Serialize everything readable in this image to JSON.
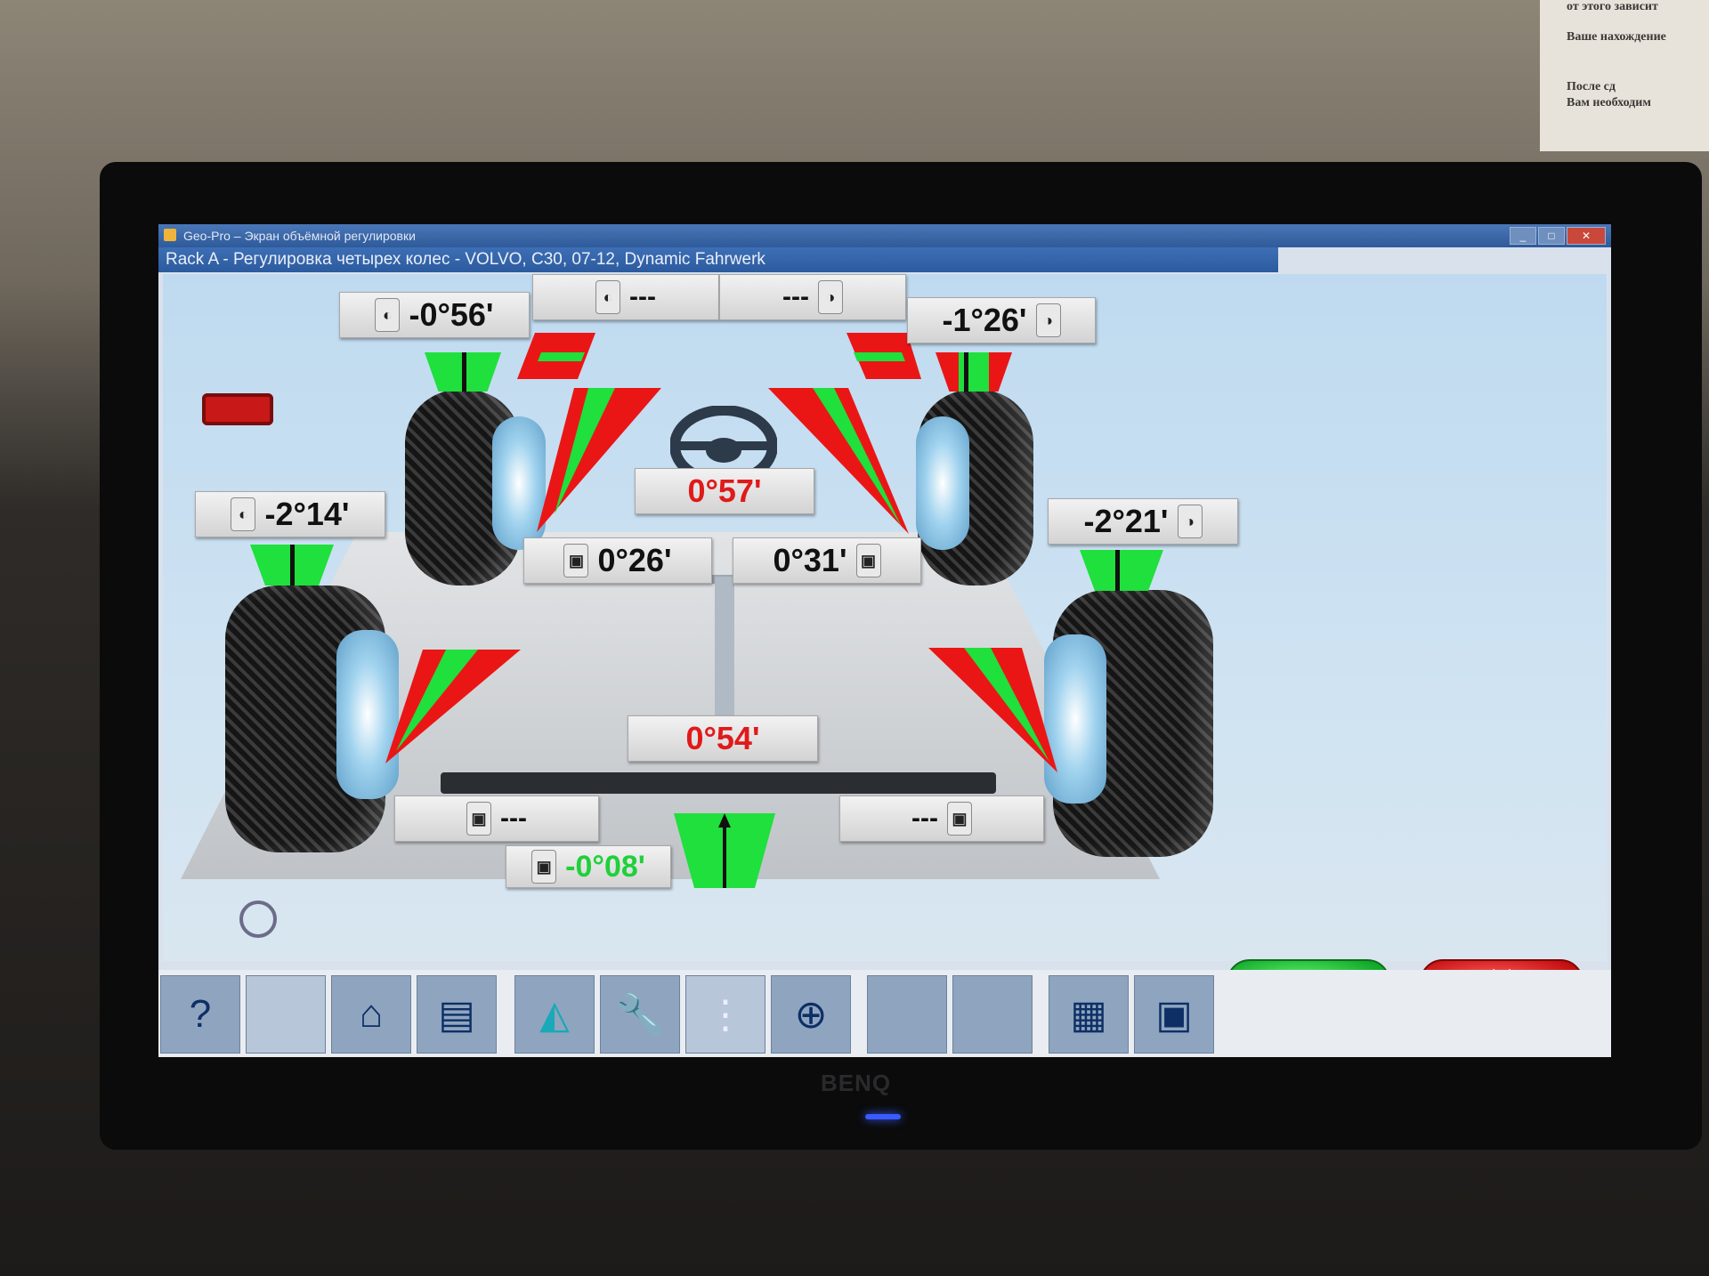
{
  "window": {
    "title": "Geo-Pro – Экран объёмной регулировки",
    "controls": [
      "_",
      "□",
      "✕"
    ]
  },
  "header": {
    "text": "Rack A - Регулировка четырех колес - VOLVO, C30, 07-12, Dynamic Fahrwerk"
  },
  "front": {
    "camber_left": "-0°56'",
    "camber_right": "-1°26'",
    "caster_left": "---",
    "caster_right": "---",
    "total_toe": "0°57'",
    "toe_left": "0°26'",
    "toe_right": "0°31'"
  },
  "rear": {
    "camber_left": "-2°14'",
    "camber_right": "-2°21'",
    "total_toe": "0°54'",
    "toe_left": "---",
    "toe_right": "---",
    "thrust_angle": "-0°08'"
  },
  "buttons": {
    "ok": "✓",
    "cancel": "✕"
  },
  "toolbar": [
    {
      "name": "help-button",
      "icon": "help-icon",
      "glyph": "?"
    },
    {
      "name": "blank-button-1",
      "icon": "blank-icon",
      "glyph": ""
    },
    {
      "name": "home-button",
      "icon": "home-icon",
      "glyph": "⌂"
    },
    {
      "name": "print-button",
      "icon": "printer-icon",
      "glyph": "▤"
    },
    {
      "name": "measure-button",
      "icon": "protractor-icon",
      "glyph": "◭"
    },
    {
      "name": "adjust-button",
      "icon": "wrench-icon",
      "glyph": "🔧"
    },
    {
      "name": "list-button",
      "icon": "list-icon",
      "glyph": "⋮"
    },
    {
      "name": "zoom-button",
      "icon": "zoom-icon",
      "glyph": "⊕"
    },
    {
      "name": "blank-button-2",
      "icon": "blank-icon",
      "glyph": ""
    },
    {
      "name": "blank-button-3",
      "icon": "blank-icon",
      "glyph": ""
    },
    {
      "name": "report-button",
      "icon": "table-icon",
      "glyph": "▦"
    },
    {
      "name": "screen-button",
      "icon": "screen-icon",
      "glyph": "▣"
    }
  ],
  "colors": {
    "ok": "#1fd03a",
    "bad": "#e01a1a",
    "stage": "#cfe3f2"
  },
  "monitor": {
    "brand": "BENQ"
  }
}
